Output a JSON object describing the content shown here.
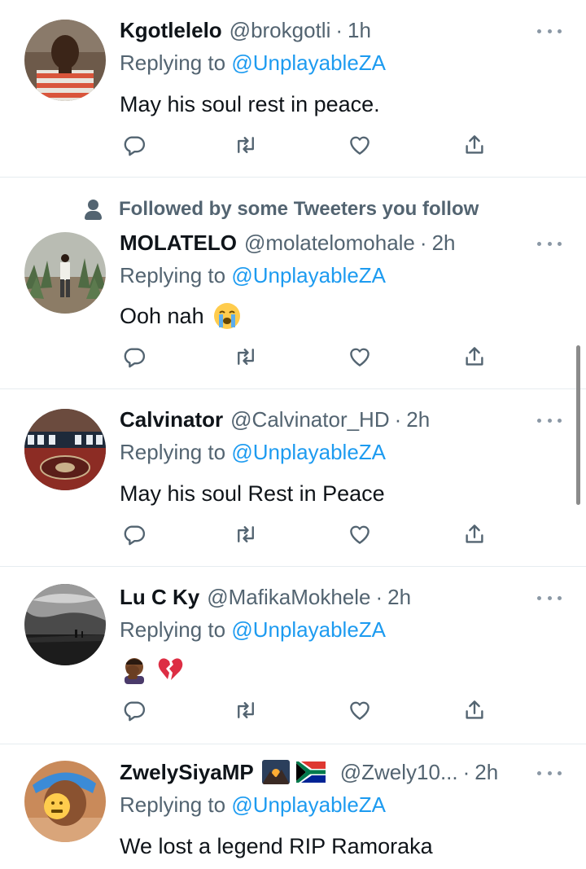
{
  "colors": {
    "accent": "#1d9bf0",
    "text": "#0f1419",
    "secondary": "#536471",
    "divider": "#e6ecf0"
  },
  "icons": {
    "reply": "reply-icon",
    "retweet": "retweet-icon",
    "like": "heart-icon",
    "share": "share-icon",
    "more": "more-icon",
    "social_context": "person-icon"
  },
  "tweets": [
    {
      "display_name": "Kgotlelelo",
      "handle": "@brokgotli",
      "separator": "·",
      "time": "1h",
      "reply_prefix": "Replying to",
      "reply_to": "@UnplayableZA",
      "text": "May his soul rest in peace."
    },
    {
      "social_context": "Followed by some Tweeters you follow",
      "display_name": "MOLATELO",
      "handle": "@molatelomohale",
      "separator": "·",
      "time": "2h",
      "reply_prefix": "Replying to",
      "reply_to": "@UnplayableZA",
      "text": "Ooh nah",
      "emojis": [
        "loudly-crying-face"
      ]
    },
    {
      "display_name": "Calvinator",
      "handle": "@Calvinator_HD",
      "separator": "·",
      "time": "2h",
      "reply_prefix": "Replying to",
      "reply_to": "@UnplayableZA",
      "text": "May his soul Rest in Peace"
    },
    {
      "display_name": "Lu C Ky",
      "handle": "@MafikaMokhele",
      "separator": "·",
      "time": "2h",
      "reply_prefix": "Replying to",
      "reply_to": "@UnplayableZA",
      "text": "",
      "emojis": [
        "man-facepalming",
        "broken-heart"
      ]
    },
    {
      "display_name": "ZwelySiyaMP",
      "name_badges": [
        "sunrise-over-mountains",
        "flag-south-africa"
      ],
      "handle": "@Zwely10...",
      "separator": "·",
      "time": "2h",
      "reply_prefix": "Replying to",
      "reply_to": "@UnplayableZA",
      "text": "We lost a legend RIP Ramoraka"
    }
  ]
}
